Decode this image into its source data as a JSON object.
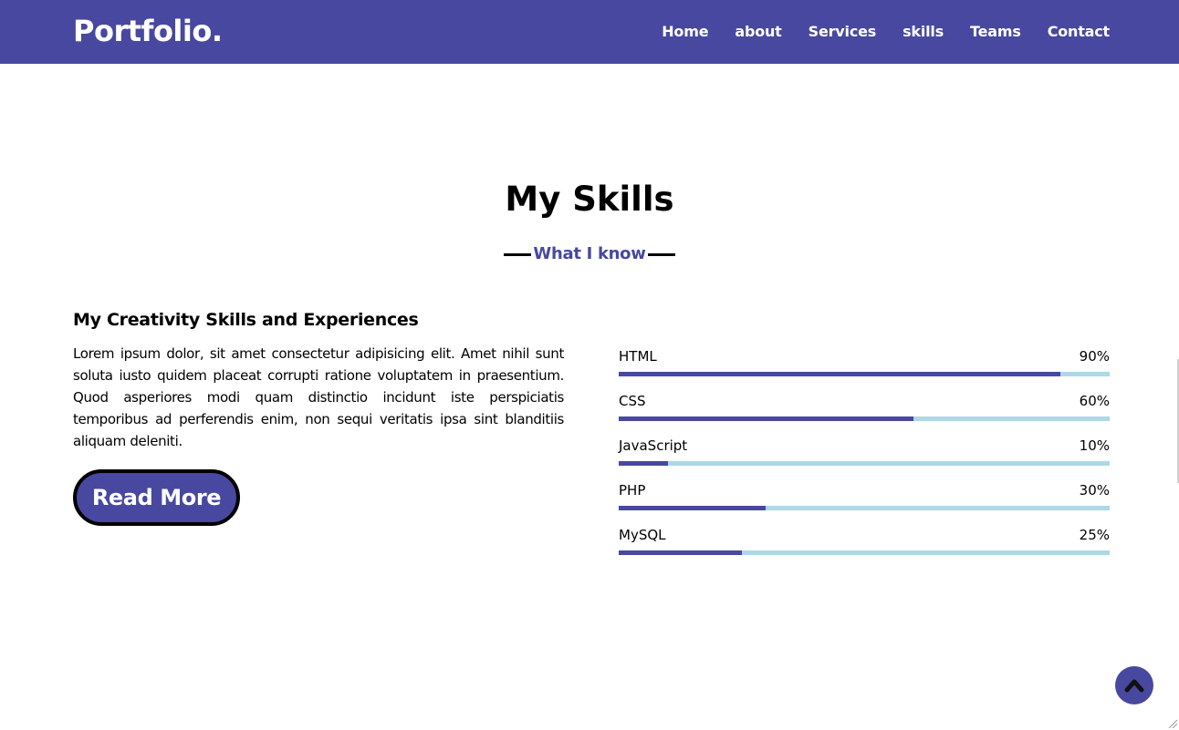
{
  "navbar": {
    "logo": "Portfolio.",
    "menu": [
      "Home",
      "about",
      "Services",
      "skills",
      "Teams",
      "Contact"
    ]
  },
  "section": {
    "title": "My Skills",
    "subtitle": "What I know"
  },
  "about": {
    "heading": "My Creativity Skills and Experiences",
    "text": "Lorem ipsum dolor, sit amet consectetur adipisicing elit. Amet nihil sunt soluta iusto quidem placeat corrupti ratione voluptatem in praesentium. Quod asperiores modi quam distinctio incidunt iste perspiciatis temporibus ad perferendis enim, non sequi veritatis ipsa sint blanditiis aliquam deleniti.",
    "button": "Read More"
  },
  "skills": [
    {
      "name": "HTML",
      "percent_label": "90%",
      "level": 0.9
    },
    {
      "name": "CSS",
      "percent_label": "60%",
      "level": 0.6
    },
    {
      "name": "JavaScript",
      "percent_label": "10%",
      "level": 0.1
    },
    {
      "name": "PHP",
      "percent_label": "30%",
      "level": 0.3
    },
    {
      "name": "MySQL",
      "percent_label": "25%",
      "level": 0.25
    }
  ],
  "scroll_top": {
    "icon": "chevron-up-icon"
  },
  "colors": {
    "primary": "#4848a0",
    "bar_track": "#add8e6",
    "text": "#000000",
    "background": "#ffffff"
  }
}
